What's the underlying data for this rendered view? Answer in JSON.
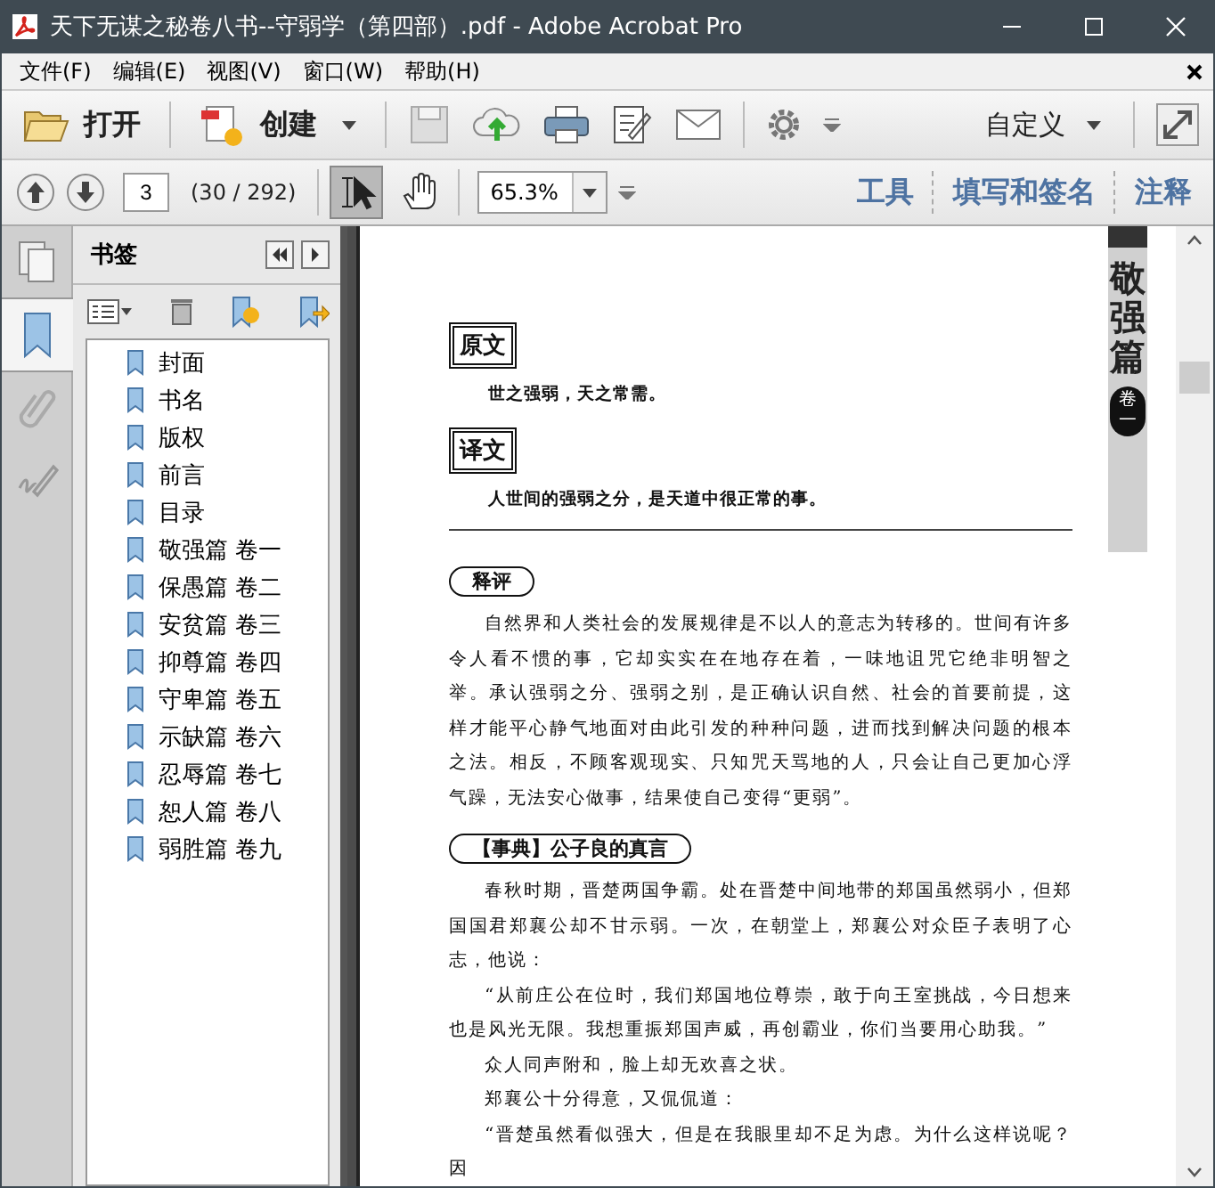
{
  "window": {
    "title": "天下无谋之秘卷八书--守弱学（第四部）.pdf - Adobe Acrobat Pro"
  },
  "menu": [
    "文件(F)",
    "编辑(E)",
    "视图(V)",
    "窗口(W)",
    "帮助(H)"
  ],
  "toolbar": {
    "open_label": "打开",
    "create_label": "创建",
    "customize_label": "自定义"
  },
  "nav_bar": {
    "page": "3",
    "page_count": "(30 / 292)",
    "zoom": "65.3%",
    "tools": [
      {
        "kind": "select",
        "selected": true
      },
      {
        "kind": "hand",
        "selected": false
      }
    ],
    "links": [
      "工具",
      "填写和签名",
      "注释"
    ]
  },
  "rail": [
    {
      "kind": "pages",
      "selected": false
    },
    {
      "kind": "bookmarks",
      "selected": true
    },
    {
      "kind": "attachments",
      "selected": false
    },
    {
      "kind": "signatures",
      "selected": false
    }
  ],
  "bookmarks_panel": {
    "title": "书签",
    "items": [
      "封面",
      "书名",
      "版权",
      "前言",
      "目录",
      "敬强篇 卷一",
      "保愚篇 卷二",
      "安贫篇 卷三",
      "抑尊篇 卷四",
      "守卑篇 卷五",
      "示缺篇 卷六",
      "忍辱篇 卷七",
      "恕人篇 卷八",
      "弱胜篇 卷九"
    ]
  },
  "document": {
    "side_tab": {
      "title": "敬强篇",
      "volume_label": "卷",
      "volume_number": "一"
    },
    "blocks": [
      {
        "kind": "boxed_heading",
        "text": "原文"
      },
      {
        "kind": "verse",
        "text": "世之强弱，天之常需。"
      },
      {
        "kind": "boxed_heading",
        "text": "译文"
      },
      {
        "kind": "verse",
        "text": "人世间的强弱之分，是天道中很正常的事。"
      },
      {
        "kind": "rule"
      },
      {
        "kind": "banner_heading",
        "text": "释评"
      },
      {
        "kind": "paragraph",
        "text": "自然界和人类社会的发展规律是不以人的意志为转移的。世间有许多令人看不惯的事，它却实实在在地存在着，一味地诅咒它绝非明智之举。承认强弱之分、强弱之别，是正确认识自然、社会的首要前提，这样才能平心静气地面对由此引发的种种问题，进而找到解决问题的根本之法。相反，不顾客观现实、只知咒天骂地的人，只会让自己更加心浮气躁，无法安心做事，结果使自己变得“更弱”。"
      },
      {
        "kind": "banner_heading",
        "text": "【事典】公子良的真言"
      },
      {
        "kind": "paragraph",
        "text": "春秋时期，晋楚两国争霸。处在晋楚中间地带的郑国虽然弱小，但郑国国君郑襄公却不甘示弱。一次，在朝堂上，郑襄公对众臣子表明了心志，他说："
      },
      {
        "kind": "paragraph",
        "text": "“从前庄公在位时，我们郑国地位尊崇，敢于向王室挑战，今日想来也是风光无限。我想重振郑国声威，再创霸业，你们当要用心助我。”"
      },
      {
        "kind": "paragraph",
        "text": "众人同声附和，脸上却无欢喜之状。"
      },
      {
        "kind": "paragraph",
        "text": "郑襄公十分得意，又侃侃道："
      },
      {
        "kind": "paragraph",
        "text": "“晋楚虽然看似强大，但是在我眼里却不足为虑。为什么这样说呢？因"
      }
    ]
  }
}
